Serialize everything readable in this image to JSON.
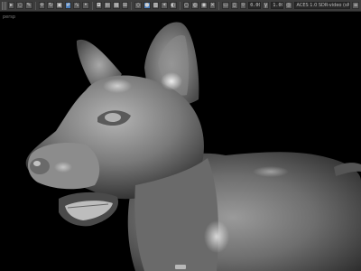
{
  "app": {
    "viewport_label": "persp",
    "edge_label": "",
    "camera_field": "ACES 1.0 SDR-video (sRGB)",
    "numeric_field_1": "0.00",
    "numeric_field_2": "1.00",
    "status_badge": "",
    "accent_color": "#4a7fbf"
  },
  "toolbar": {
    "icons": [
      "select-icon",
      "lasso-icon",
      "paint-icon",
      "move-icon",
      "rotate-icon",
      "scale-icon",
      "snap-grid-icon",
      "snap-curve-icon",
      "snap-point-icon",
      "camera-icon",
      "bookmark-icon",
      "image-plane-icon",
      "grid-icon",
      "wireframe-icon",
      "smooth-shade-icon",
      "textured-icon",
      "lights-icon",
      "shadows-icon",
      "ao-icon",
      "aa-icon",
      "isolate-icon",
      "xray-icon",
      "resolution-gate-icon",
      "film-gate-icon",
      "exposure-icon",
      "gamma-icon"
    ]
  }
}
